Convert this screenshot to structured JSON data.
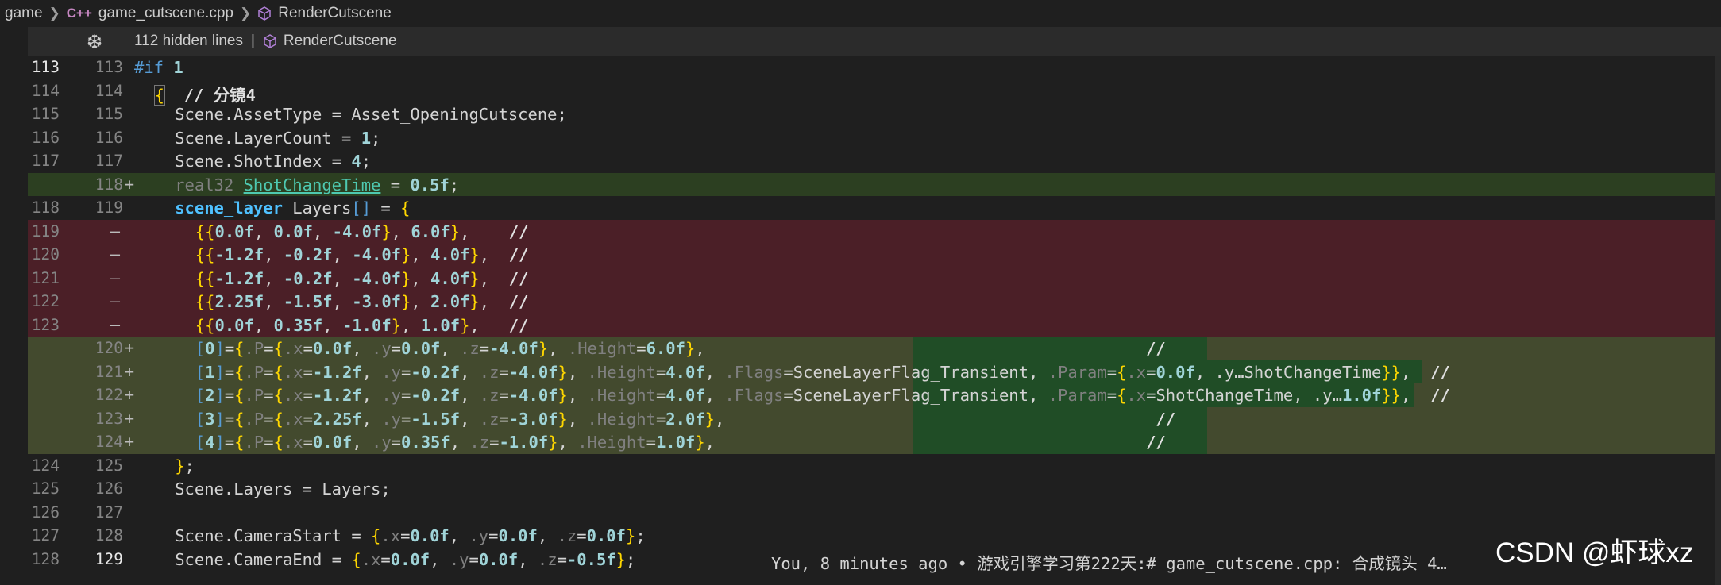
{
  "breadcrumb": {
    "root": "game",
    "file": "game_cutscene.cpp",
    "symbol": "RenderCutscene"
  },
  "hidden_bar": {
    "count_text": "112 hidden lines",
    "pipe": "|",
    "symbol": "RenderCutscene"
  },
  "lines": [
    {
      "left": "113",
      "right": "113",
      "mark": "",
      "code": "#if 1",
      "type": "ctx"
    },
    {
      "left": "114",
      "right": "114",
      "mark": "",
      "code": "{ // 分镜4",
      "type": "ctx"
    },
    {
      "left": "115",
      "right": "115",
      "mark": "",
      "code": "Scene.AssetType = Asset_OpeningCutscene;",
      "type": "ctx"
    },
    {
      "left": "116",
      "right": "116",
      "mark": "",
      "code": "Scene.LayerCount = 1;",
      "type": "ctx"
    },
    {
      "left": "117",
      "right": "117",
      "mark": "",
      "code": "Scene.ShotIndex = 4;",
      "type": "ctx"
    },
    {
      "left": "",
      "right": "118",
      "mark": "+",
      "code": "real32 ShotChangeTime = 0.5f;",
      "type": "add"
    },
    {
      "left": "118",
      "right": "119",
      "mark": "",
      "code": "scene_layer Layers[] = {",
      "type": "ctx"
    },
    {
      "left": "119",
      "right": "",
      "mark": "—",
      "code": "{{0.0f, 0.0f, -4.0f}, 6.0f},    //",
      "type": "del"
    },
    {
      "left": "120",
      "right": "",
      "mark": "—",
      "code": "{{-1.2f, -0.2f, -4.0f}, 4.0f},  //",
      "type": "del"
    },
    {
      "left": "121",
      "right": "",
      "mark": "—",
      "code": "{{-1.2f, -0.2f, -4.0f}, 4.0f},  //",
      "type": "del"
    },
    {
      "left": "122",
      "right": "",
      "mark": "—",
      "code": "{{2.25f, -1.5f, -3.0f}, 2.0f},  //",
      "type": "del"
    },
    {
      "left": "123",
      "right": "",
      "mark": "—",
      "code": "{{0.0f, 0.35f, -1.0f}, 1.0f},   //",
      "type": "del"
    },
    {
      "left": "",
      "right": "120",
      "mark": "+",
      "code": "[0]={.P={.x=0.0f, .y=0.0f, .z=-4.0f}, .Height=6.0f},                                             //",
      "type": "add2"
    },
    {
      "left": "",
      "right": "121",
      "mark": "+",
      "code": "[1]={.P={.x=-1.2f, .y=-0.2f, .z=-4.0f}, .Height=4.0f, .Flags=SceneLayerFlag_Transient, .Param={.x=0.0f, .y…ShotChangeTime}},  //",
      "type": "add2"
    },
    {
      "left": "",
      "right": "122",
      "mark": "+",
      "code": "[2]={.P={.x=-1.2f, .y=-0.2f, .z=-4.0f}, .Height=4.0f, .Flags=SceneLayerFlag_Transient, .Param={.x=ShotChangeTime, .y…1.0f}},  //",
      "type": "add2"
    },
    {
      "left": "",
      "right": "123",
      "mark": "+",
      "code": "[3]={.P={.x=2.25f, .y=-1.5f, .z=-3.0f}, .Height=2.0f},                                            //",
      "type": "add2"
    },
    {
      "left": "",
      "right": "124",
      "mark": "+",
      "code": "[4]={.P={.x=0.0f, .y=0.35f, .z=-1.0f}, .Height=1.0f},                                            //",
      "type": "add2"
    },
    {
      "left": "124",
      "right": "125",
      "mark": "",
      "code": "};",
      "type": "ctx"
    },
    {
      "left": "125",
      "right": "126",
      "mark": "",
      "code": "Scene.Layers = Layers;",
      "type": "ctx"
    },
    {
      "left": "126",
      "right": "127",
      "mark": "",
      "code": "",
      "type": "ctx"
    },
    {
      "left": "127",
      "right": "128",
      "mark": "",
      "code": "Scene.CameraStart = {.x=0.0f, .y=0.0f, .z=0.0f};",
      "type": "ctx"
    },
    {
      "left": "128",
      "right": "129",
      "mark": "",
      "code": "Scene.CameraEnd = {.x=0.0f, .y=0.0f, .z=-0.5f};",
      "type": "ctx"
    }
  ],
  "blame": "You, 8 minutes ago • 游戏引擎学习第222天:# game_cutscene.cpp: 合成镜头 4…",
  "watermark": "CSDN @虾球xz",
  "colors": {
    "added_bg": "#2c3f21",
    "added_inner_bg": "#204d26",
    "deleted_bg": "#4b1f27",
    "editor_bg": "#1f1f1f"
  }
}
